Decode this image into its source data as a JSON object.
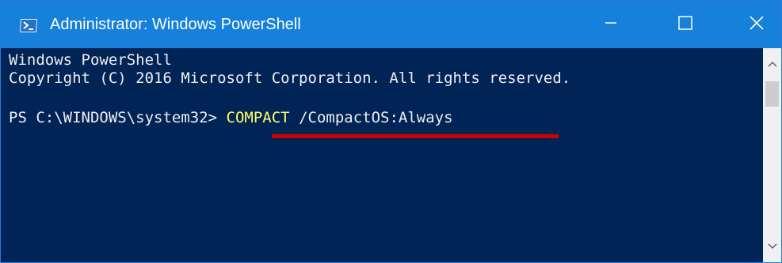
{
  "window": {
    "title": "Administrator: Windows PowerShell"
  },
  "console": {
    "lines": [
      "Windows PowerShell",
      "Copyright (C) 2016 Microsoft Corporation. All rights reserved."
    ],
    "prompt": "PS C:\\WINDOWS\\system32> ",
    "command": "COMPACT",
    "argument": " /CompactOS:Always"
  },
  "icons": {
    "app": "powershell-icon",
    "minimize": "minimize-icon",
    "maximize": "maximize-icon",
    "close": "close-icon",
    "scroll_up": "chevron-up-icon",
    "scroll_down": "chevron-down-icon"
  },
  "colors": {
    "titlebar": "#1680da",
    "console_background": "#012456",
    "console_text": "#eeedf0",
    "command_highlight": "#ffff66",
    "annotation_underline": "#d00000",
    "scrollbar": "#f0f0f0"
  }
}
